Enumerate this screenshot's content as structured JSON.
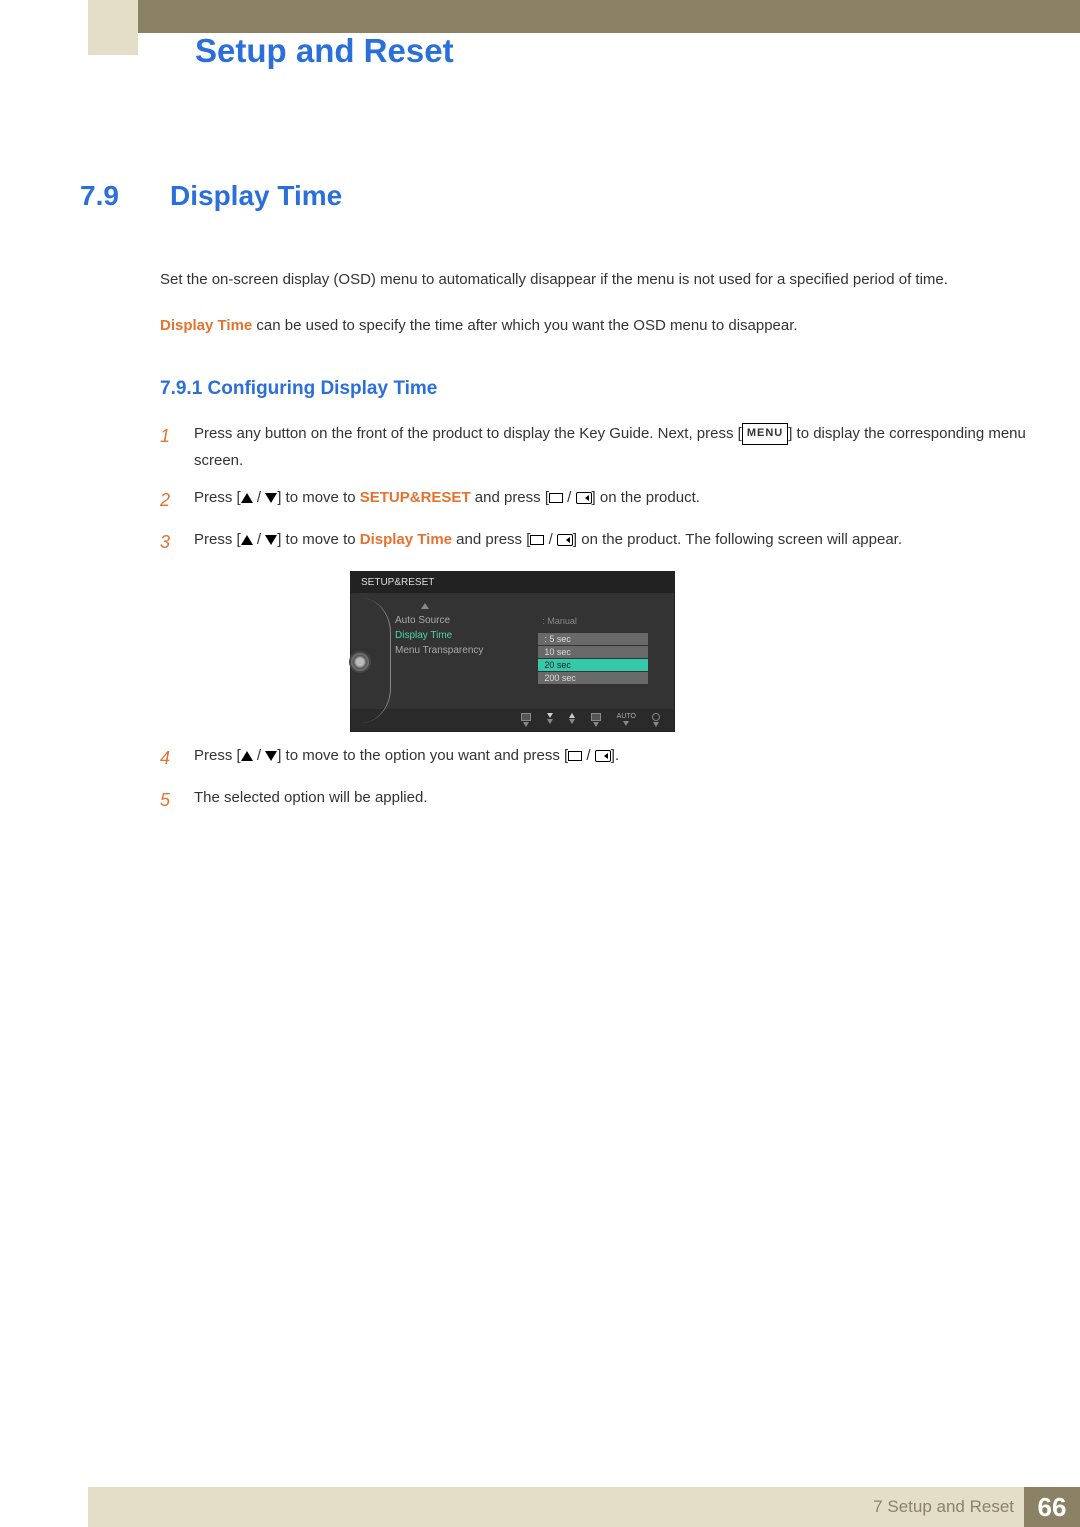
{
  "chapter_title": "Setup and Reset",
  "section": {
    "num": "7.9",
    "title": "Display Time"
  },
  "intro_para": "Set the on-screen display (OSD) menu to automatically disappear if the menu is not used for a specified period of time.",
  "intro2_prefix": "Display Time",
  "intro2_rest": " can be used to specify the time after which you want the OSD menu to disappear.",
  "subsection": "7.9.1  Configuring Display Time",
  "steps": {
    "s1_num": "1",
    "s1a": "Press any button on the front of the product to display the Key Guide. Next, press [",
    "s1_menu": "MENU",
    "s1b": "] to display the corresponding menu screen.",
    "s2_num": "2",
    "s2a": "Press [",
    "s2b": "] to move to ",
    "s2_target": "SETUP&RESET",
    "s2c": " and press [",
    "s2d": "] on the product.",
    "s3_num": "3",
    "s3a": "Press [",
    "s3b": "] to move to ",
    "s3_target": "Display Time",
    "s3c": " and press [",
    "s3d": "] on the product. The following screen will appear.",
    "s4_num": "4",
    "s4a": "Press [",
    "s4b": "] to move to the option you want and press [",
    "s4c": "].",
    "s5_num": "5",
    "s5": "The selected option will be applied."
  },
  "osd": {
    "title": "SETUP&RESET",
    "items": [
      "Auto Source",
      "Display Time",
      "Menu Transparency"
    ],
    "manual": "Manual",
    "opts": [
      "5 sec",
      "10 sec",
      "20 sec",
      "200 sec"
    ],
    "auto": "AUTO"
  },
  "footer": {
    "text": "7 Setup and Reset",
    "page": "66"
  }
}
